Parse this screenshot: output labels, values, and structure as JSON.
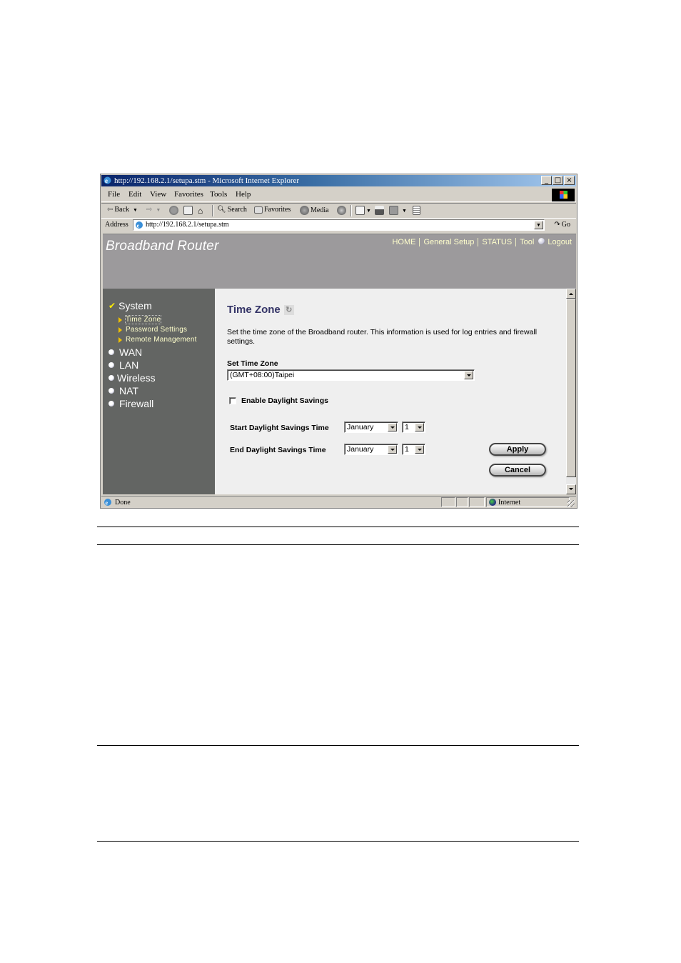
{
  "browser": {
    "title": "http://192.168.2.1/setupa.stm - Microsoft Internet Explorer",
    "window_buttons": [
      "minimize",
      "maximize",
      "close"
    ],
    "menu": [
      "File",
      "Edit",
      "View",
      "Favorites",
      "Tools",
      "Help"
    ],
    "toolbar": {
      "back": "Back",
      "search": "Search",
      "favorites": "Favorites",
      "media": "Media"
    },
    "address_label": "Address",
    "address_value": "http://192.168.2.1/setupa.stm",
    "go_label": "Go",
    "status_text": "Done",
    "zone_text": "Internet"
  },
  "router": {
    "brand": "Broadband Router",
    "topnav": [
      "HOME",
      "General Setup",
      "STATUS",
      "Tool",
      "Logout"
    ],
    "sidebar": {
      "sections": [
        {
          "label": "System",
          "expanded": true,
          "children": [
            "Time Zone",
            "Password Settings",
            "Remote Management"
          ]
        },
        {
          "label": "WAN"
        },
        {
          "label": "LAN"
        },
        {
          "label": "Wireless"
        },
        {
          "label": "NAT"
        },
        {
          "label": "Firewall"
        }
      ],
      "active_child": "Time Zone"
    },
    "page": {
      "title": "Time Zone",
      "description": "Set the time zone of the Broadband router. This information is used for log entries and firewall settings.",
      "time_zone_label": "Set Time Zone",
      "time_zone_value": "(GMT+08:00)Taipei",
      "daylight_checkbox_label": "Enable Daylight Savings",
      "daylight_enabled": false,
      "start_label": "Start Daylight Savings Time",
      "start_month": "January",
      "start_day": "1",
      "end_label": "End Daylight Savings Time",
      "end_month": "January",
      "end_day": "1",
      "apply_label": "Apply",
      "cancel_label": "Cancel"
    }
  }
}
